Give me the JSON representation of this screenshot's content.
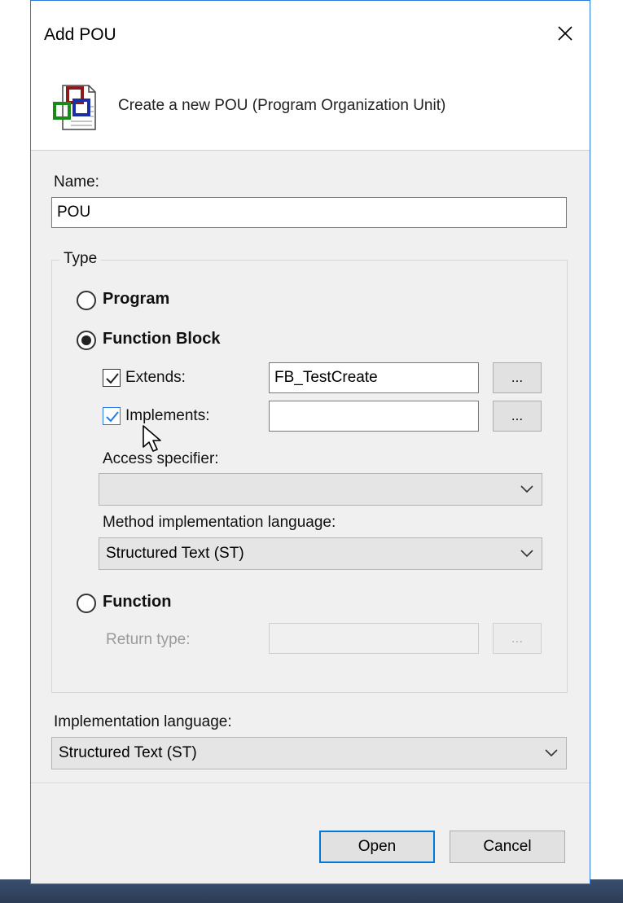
{
  "dialog": {
    "title": "Add POU",
    "header_icon": "pou-icon",
    "header_text": "Create a new POU (Program Organization Unit)"
  },
  "name": {
    "label": "Name:",
    "value": "POU"
  },
  "type_group": {
    "legend": "Type",
    "program_label": "Program",
    "function_block_label": "Function Block",
    "selected": "Function Block",
    "extends": {
      "label": "Extends:",
      "checked": true,
      "value": "FB_TestCreate",
      "browse": "..."
    },
    "implements": {
      "label": "Implements:",
      "checked": true,
      "value": "",
      "browse": "..."
    },
    "access_specifier": {
      "label": "Access specifier:",
      "value": ""
    },
    "method_language": {
      "label": "Method implementation language:",
      "value": "Structured Text (ST)"
    },
    "function_label": "Function",
    "return_type": {
      "label": "Return type:",
      "value": "",
      "browse": "..."
    }
  },
  "implementation_language": {
    "label": "Implementation language:",
    "value": "Structured Text (ST)"
  },
  "footer": {
    "open_label": "Open",
    "cancel_label": "Cancel"
  },
  "colors": {
    "accent": "#0078d7",
    "dialog_bg": "#f0f0f0"
  }
}
